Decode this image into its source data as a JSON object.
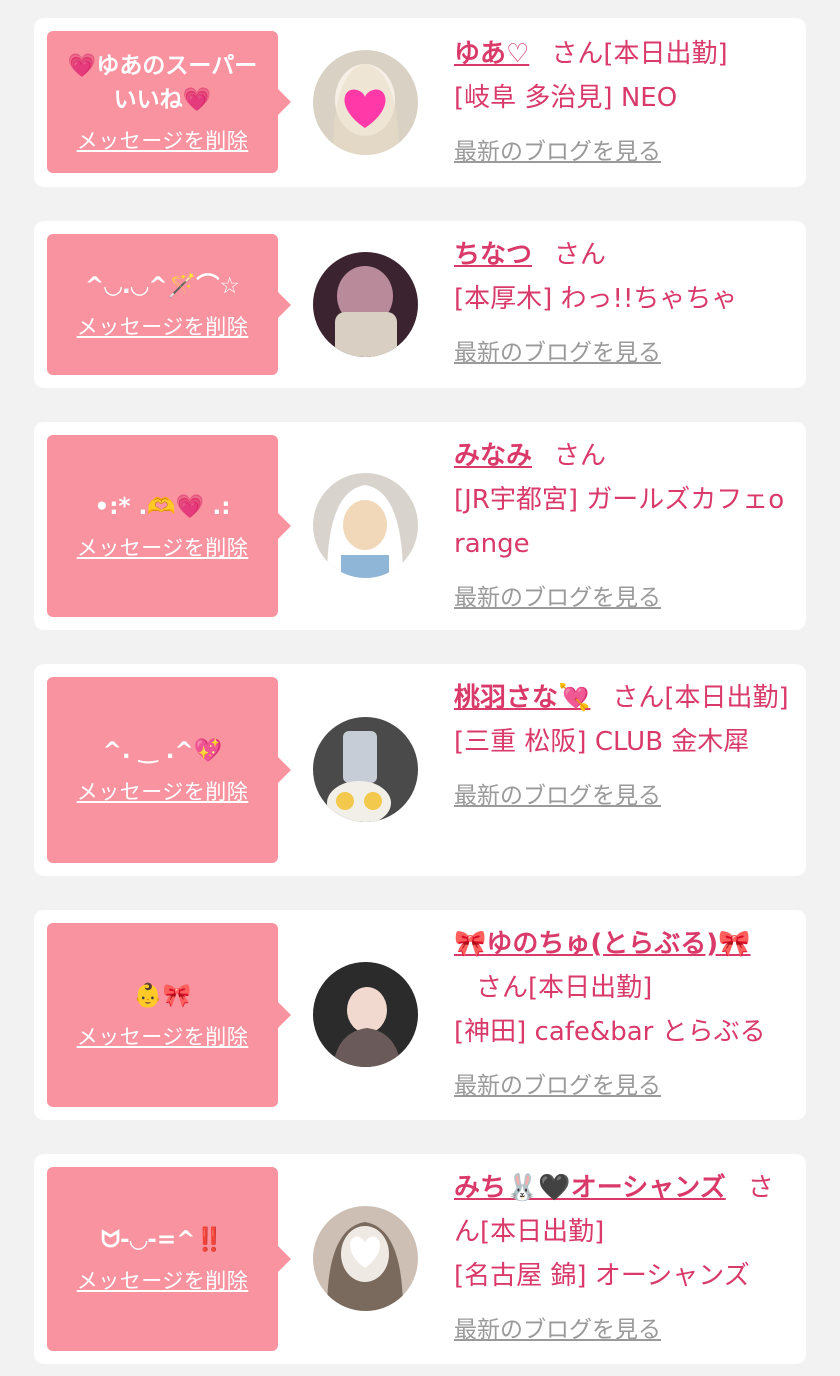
{
  "cards": [
    {
      "message_lines": [
        "💗ゆあのスーパー",
        "いいね💗"
      ],
      "delete_label": "メッセージを削除",
      "name": "ゆあ♡",
      "san": "さん",
      "status": "[本日出勤]",
      "shop": "[岐阜 多治見] NEO",
      "blog_label": "最新のブログを見る",
      "avatar_icon": "heart-sticker-icon",
      "avatar_colors": [
        "#d9d2c4",
        "#f6efe6",
        "#e9dcc6"
      ]
    },
    {
      "message_lines": [
        "^◡.◡^🪄⌒☆"
      ],
      "delete_label": "メッセージを削除",
      "name": "ちなつ",
      "san": "さん",
      "status": "",
      "shop": "[本厚木] わっ!!ちゃちゃ",
      "blog_label": "最新のブログを見る",
      "avatar_icon": "",
      "avatar_colors": [
        "#3b2430",
        "#b98a9a",
        "#d9cfc2"
      ]
    },
    {
      "message_lines": [
        "•:* .🫶💗 .:"
      ],
      "delete_label": "メッセージを削除",
      "name": "みなみ",
      "san": "さん",
      "status": "",
      "shop": "[JR宇都宮] ガールズカフェorange",
      "blog_label": "最新のブログを見る",
      "avatar_icon": "",
      "avatar_colors": [
        "#d8d3cc",
        "#f0d8b8",
        "#8fb6d6"
      ]
    },
    {
      "message_lines": [
        "^. ‿ .^💖"
      ],
      "delete_label": "メッセージを削除",
      "name": "桃羽さな💘",
      "san": "さん",
      "status": "[本日出勤]",
      "shop": "[三重 松阪] CLUB 金木犀",
      "blog_label": "最新のブログを見る",
      "avatar_icon": "",
      "avatar_colors": [
        "#4a4a4a",
        "#f2efe9",
        "#f2c94c"
      ]
    },
    {
      "message_lines": [
        "👶🎀"
      ],
      "delete_label": "メッセージを削除",
      "name": "🎀ゆのちゅ(とらぶる)🎀",
      "san": "さん",
      "status": "[本日出勤]",
      "shop": "[神田] cafe&bar とらぶる",
      "blog_label": "最新のブログを見る",
      "avatar_icon": "",
      "avatar_colors": [
        "#2b2b2b",
        "#f1d9cf",
        "#6a5a5a"
      ]
    },
    {
      "message_lines": [
        "ᗢ-◡-=^‼️"
      ],
      "delete_label": "メッセージを削除",
      "name": "みち🐰🖤オーシャンズ",
      "san": "さん",
      "status": "[本日出勤]",
      "shop": "[名古屋 錦] オーシャンズ",
      "blog_label": "最新のブログを見る",
      "avatar_icon": "white-heart-sticker-icon",
      "avatar_colors": [
        "#cdbfb3",
        "#efe9e3",
        "#7a6a5e"
      ]
    }
  ],
  "colors": {
    "accent": "#d93a6a",
    "bubble": "#f8939f",
    "blog_link": "#9a9a9a",
    "background": "#f2f2f2"
  }
}
